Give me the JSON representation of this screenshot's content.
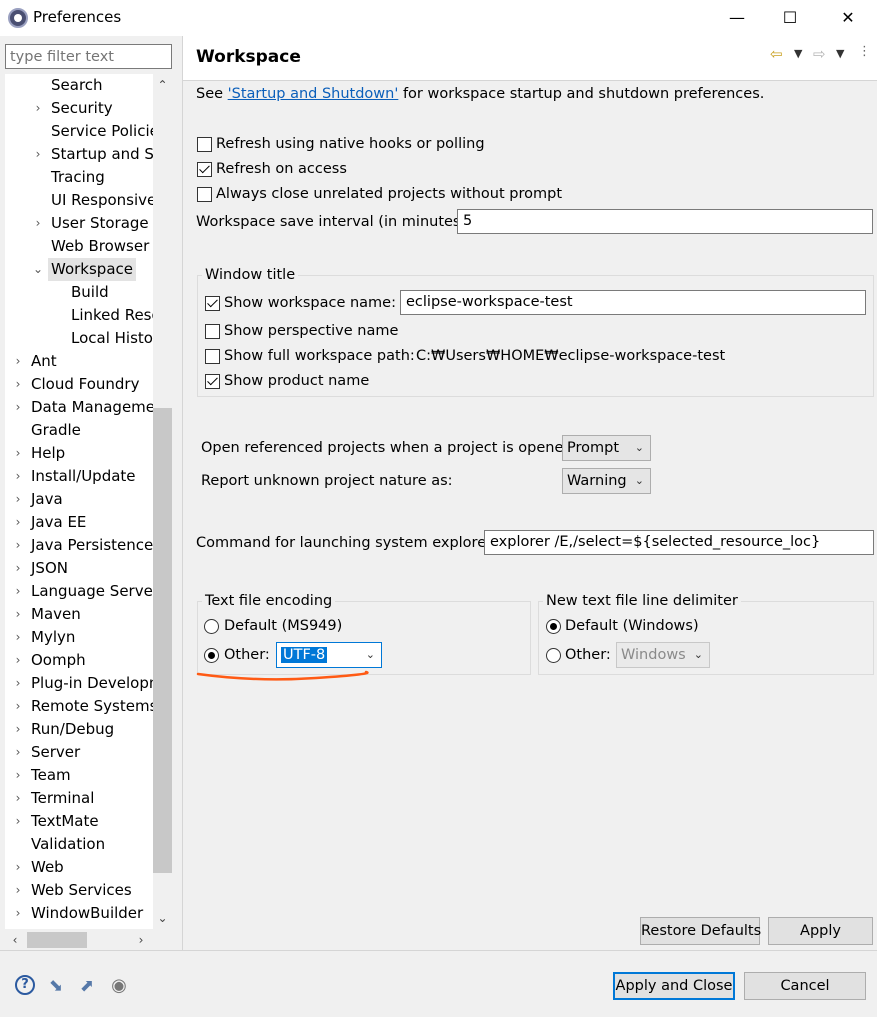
{
  "window": {
    "title": "Preferences",
    "min_glyph": "—",
    "max_glyph": "☐",
    "close_glyph": "✕"
  },
  "filter": {
    "placeholder": "type filter text"
  },
  "tree": {
    "items": [
      {
        "label": "Search",
        "chevron": "",
        "indent": 1
      },
      {
        "label": "Security",
        "chevron": "›",
        "indent": 1
      },
      {
        "label": "Service Policies",
        "chevron": "",
        "indent": 1
      },
      {
        "label": "Startup and Shutdown",
        "chevron": "›",
        "indent": 1
      },
      {
        "label": "Tracing",
        "chevron": "",
        "indent": 1
      },
      {
        "label": "UI Responsiveness",
        "chevron": "",
        "indent": 1
      },
      {
        "label": "User Storage Service",
        "chevron": "›",
        "indent": 1
      },
      {
        "label": "Web Browser",
        "chevron": "",
        "indent": 1
      },
      {
        "label": "Workspace",
        "chevron": "⌄",
        "indent": 1,
        "selected": true
      },
      {
        "label": "Build",
        "chevron": "",
        "indent": 2
      },
      {
        "label": "Linked Resources",
        "chevron": "",
        "indent": 2
      },
      {
        "label": "Local History",
        "chevron": "",
        "indent": 2
      },
      {
        "label": "Ant",
        "chevron": "›",
        "indent": 0
      },
      {
        "label": "Cloud Foundry",
        "chevron": "›",
        "indent": 0
      },
      {
        "label": "Data Management",
        "chevron": "›",
        "indent": 0
      },
      {
        "label": "Gradle",
        "chevron": "",
        "indent": 0
      },
      {
        "label": "Help",
        "chevron": "›",
        "indent": 0
      },
      {
        "label": "Install/Update",
        "chevron": "›",
        "indent": 0
      },
      {
        "label": "Java",
        "chevron": "›",
        "indent": 0
      },
      {
        "label": "Java EE",
        "chevron": "›",
        "indent": 0
      },
      {
        "label": "Java Persistence",
        "chevron": "›",
        "indent": 0
      },
      {
        "label": "JSON",
        "chevron": "›",
        "indent": 0
      },
      {
        "label": "Language Servers",
        "chevron": "›",
        "indent": 0
      },
      {
        "label": "Maven",
        "chevron": "›",
        "indent": 0
      },
      {
        "label": "Mylyn",
        "chevron": "›",
        "indent": 0
      },
      {
        "label": "Oomph",
        "chevron": "›",
        "indent": 0
      },
      {
        "label": "Plug-in Development",
        "chevron": "›",
        "indent": 0
      },
      {
        "label": "Remote Systems",
        "chevron": "›",
        "indent": 0
      },
      {
        "label": "Run/Debug",
        "chevron": "›",
        "indent": 0
      },
      {
        "label": "Server",
        "chevron": "›",
        "indent": 0
      },
      {
        "label": "Team",
        "chevron": "›",
        "indent": 0
      },
      {
        "label": "Terminal",
        "chevron": "›",
        "indent": 0
      },
      {
        "label": "TextMate",
        "chevron": "›",
        "indent": 0
      },
      {
        "label": "Validation",
        "chevron": "",
        "indent": 0
      },
      {
        "label": "Web",
        "chevron": "›",
        "indent": 0
      },
      {
        "label": "Web Services",
        "chevron": "›",
        "indent": 0
      },
      {
        "label": "WindowBuilder",
        "chevron": "›",
        "indent": 0
      }
    ]
  },
  "page": {
    "title": "Workspace",
    "intro_prefix": "See ",
    "intro_link": "'Startup and Shutdown'",
    "intro_suffix": " for workspace startup and shutdown preferences.",
    "refresh_native": "Refresh using native hooks or polling",
    "refresh_access": "Refresh on access",
    "always_close": "Always close unrelated projects without prompt",
    "save_interval_label": "Workspace save interval (in minutes):",
    "save_interval_value": "5",
    "window_title_group": "Window title",
    "show_ws_name": "Show workspace name:",
    "ws_name_value": "eclipse-workspace-test",
    "show_perspective": "Show perspective name",
    "show_full_path": "Show full workspace path:",
    "full_path_value": "C:₩Users₩HOME₩eclipse-workspace-test",
    "show_product": "Show product name",
    "open_ref_label": "Open referenced projects when a project is opened:",
    "open_ref_value": "Prompt",
    "unknown_nature_label": "Report unknown project nature as:",
    "unknown_nature_value": "Warning",
    "command_label": "Command for launching system explorer:",
    "command_value": "explorer /E,/select=${selected_resource_loc}",
    "encoding_group": "Text file encoding",
    "enc_default": "Default (MS949)",
    "enc_other": "Other:",
    "enc_other_value": "UTF-8",
    "delim_group": "New text file line delimiter",
    "delim_default": "Default (Windows)",
    "delim_other": "Other:",
    "delim_other_value": "Windows",
    "restore_defaults": "Restore Defaults",
    "apply": "Apply"
  },
  "footer": {
    "apply_close": "Apply and Close",
    "cancel": "Cancel"
  },
  "colors": {
    "accent": "#0078d7",
    "link": "#0b5fba",
    "annotation": "#ff5a14"
  }
}
